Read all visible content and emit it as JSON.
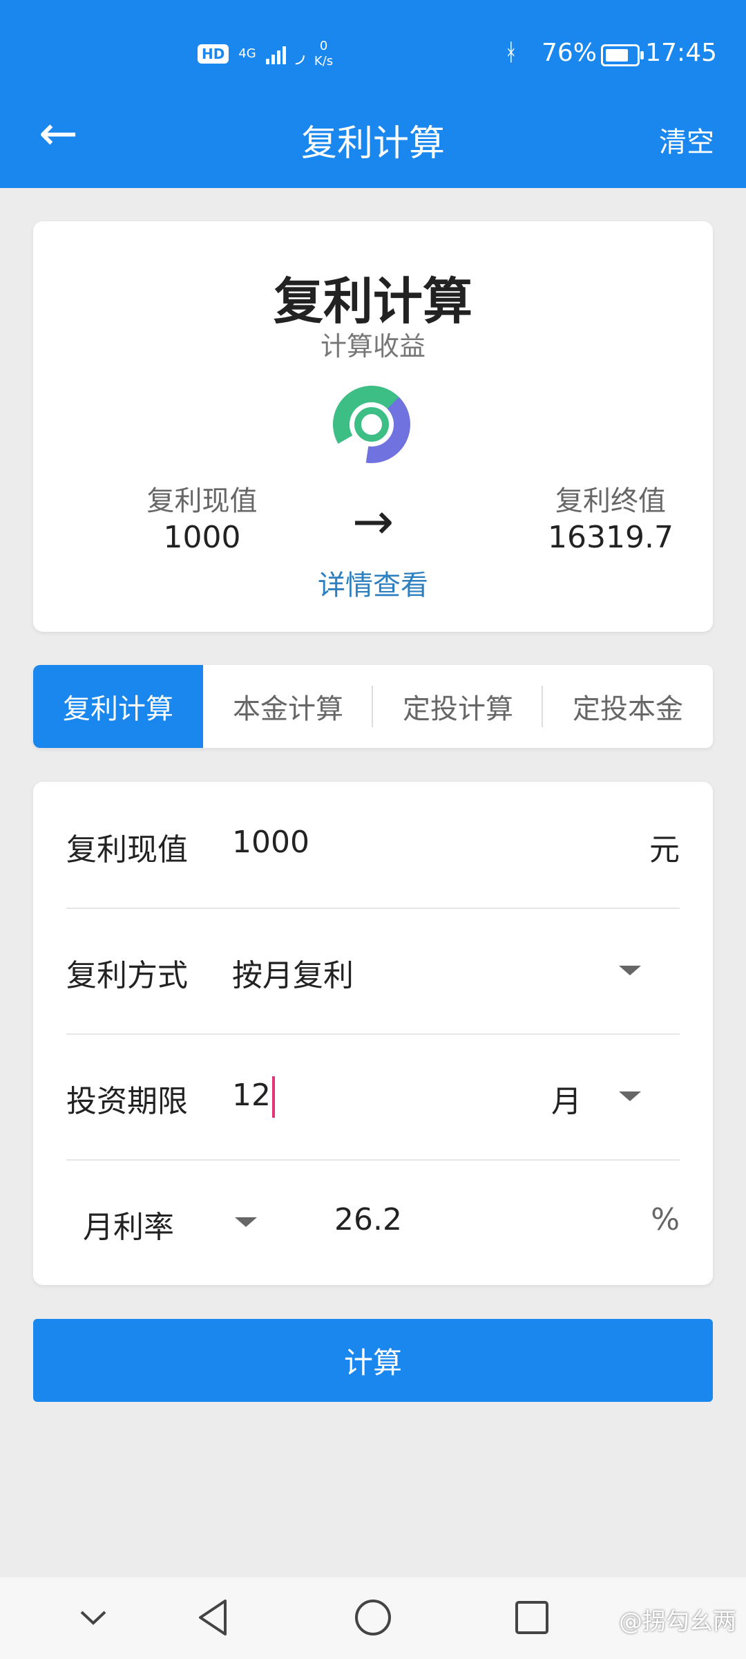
{
  "status_bar": {
    "hd_badge": "HD",
    "network": "4G",
    "speed_value": "0",
    "speed_unit": "K/s",
    "battery_percent": "76%",
    "time": "17:45"
  },
  "header": {
    "title": "复利计算",
    "clear_label": "清空"
  },
  "summary": {
    "title": "复利计算",
    "subtitle": "计算收益",
    "present_value_label": "复利现值",
    "present_value": "1000",
    "future_value_label": "复利终值",
    "future_value": "16319.7",
    "details_link": "详情查看"
  },
  "tabs": [
    {
      "label": "复利计算",
      "active": true
    },
    {
      "label": "本金计算",
      "active": false
    },
    {
      "label": "定投计算",
      "active": false
    },
    {
      "label": "定投本金",
      "active": false
    }
  ],
  "form": {
    "present_value": {
      "label": "复利现值",
      "value": "1000",
      "unit": "元"
    },
    "compound_mode": {
      "label": "复利方式",
      "value": "按月复利"
    },
    "period": {
      "label": "投资期限",
      "value": "12",
      "unit": "月"
    },
    "rate": {
      "type_label": "月利率",
      "value": "26.2",
      "unit": "%"
    }
  },
  "calculate_button": "计算",
  "watermark": "@拐勾幺两",
  "colors": {
    "primary": "#1a87ee",
    "link": "#2d7fbf",
    "cursor": "#e0357b"
  }
}
